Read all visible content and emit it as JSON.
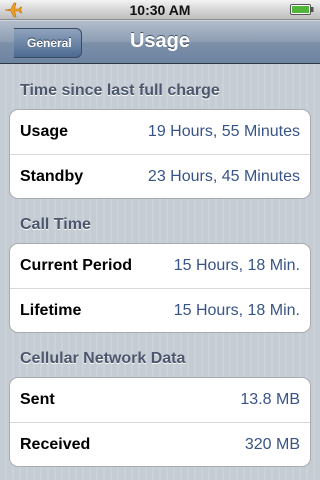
{
  "status_bar": {
    "time": "10:30 AM",
    "airplane_icon": "airplane-icon",
    "battery_icon": "battery-icon"
  },
  "nav": {
    "back_label": "General",
    "title": "Usage"
  },
  "sections": [
    {
      "header": "Time since last full charge",
      "rows": [
        {
          "label": "Usage",
          "value": "19 Hours, 55 Minutes"
        },
        {
          "label": "Standby",
          "value": "23 Hours, 45 Minutes"
        }
      ]
    },
    {
      "header": "Call Time",
      "rows": [
        {
          "label": "Current Period",
          "value": "15 Hours, 18 Min."
        },
        {
          "label": "Lifetime",
          "value": "15 Hours, 18 Min."
        }
      ]
    },
    {
      "header": "Cellular Network Data",
      "rows": [
        {
          "label": "Sent",
          "value": "13.8 MB"
        },
        {
          "label": "Received",
          "value": "320 MB"
        }
      ]
    }
  ],
  "colors": {
    "accent_value": "#385487",
    "header_text": "#4c566c",
    "nav_bar": "#6d84a2"
  }
}
